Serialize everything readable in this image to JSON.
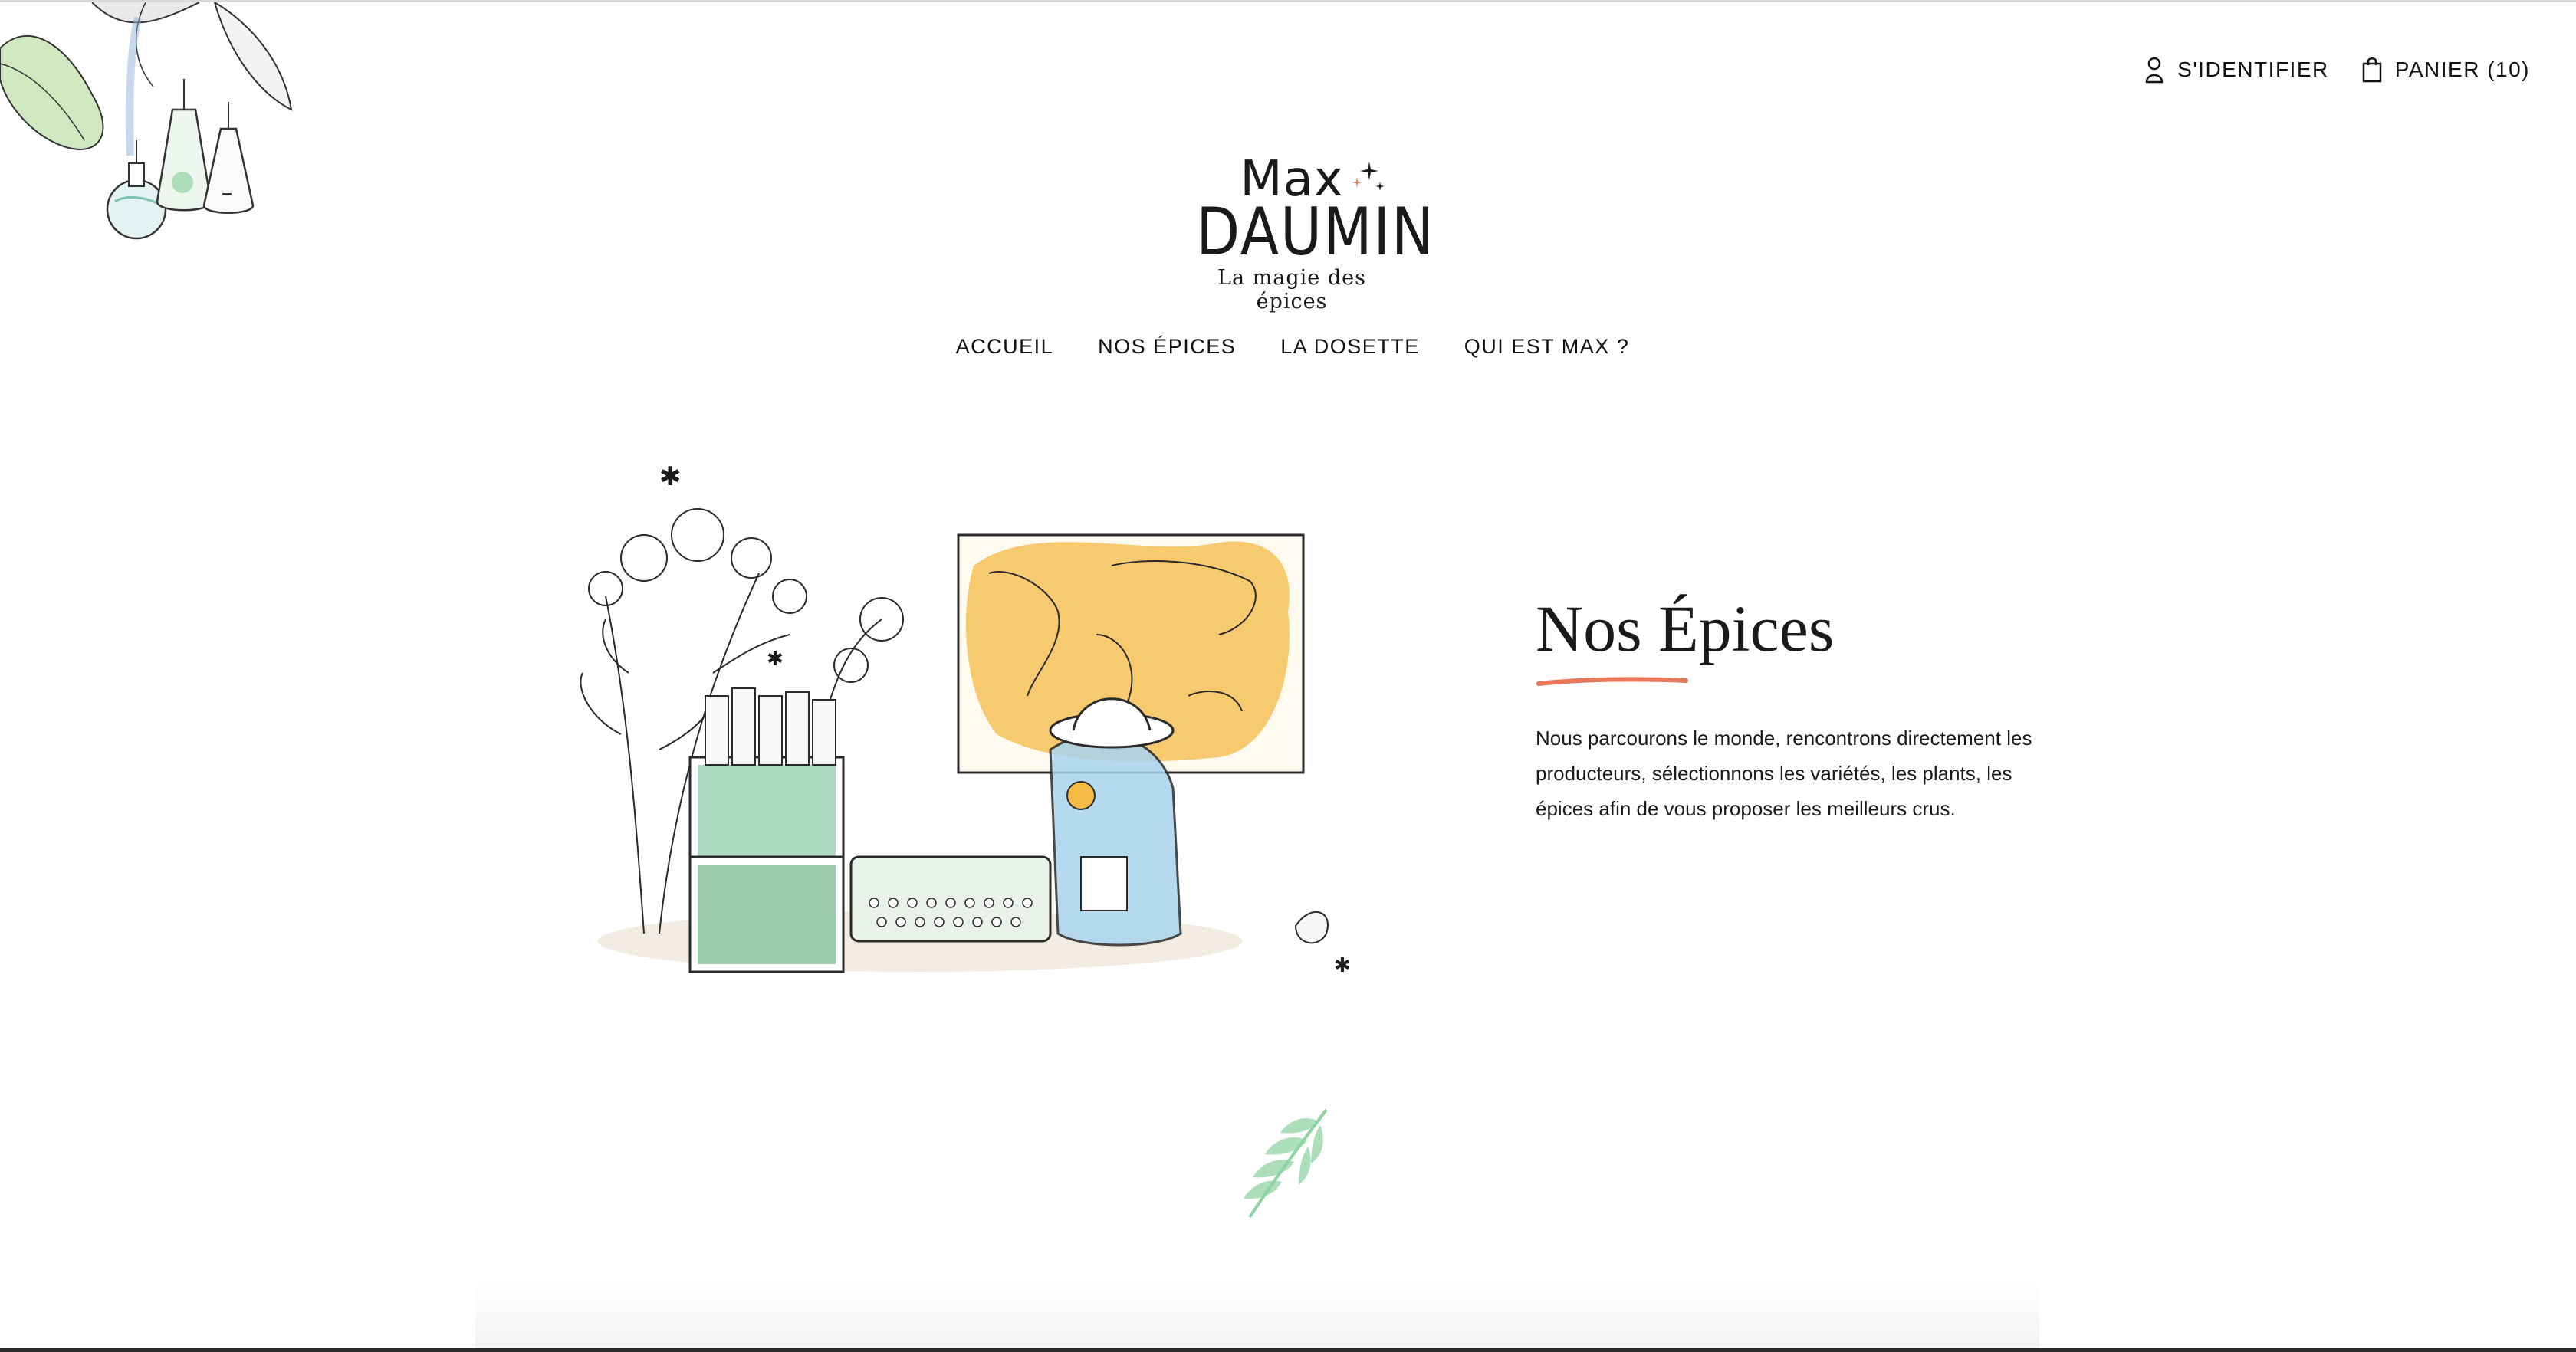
{
  "header": {
    "login_label": "S'IDENTIFIER",
    "cart_label": "PANIER (10)"
  },
  "logo": {
    "line1": "Max",
    "line2": "DAUMIN",
    "tagline": "La magie des épices"
  },
  "nav": {
    "items": [
      {
        "label": "ACCUEIL"
      },
      {
        "label": "NOS ÉPICES"
      },
      {
        "label": "LA DOSETTE"
      },
      {
        "label": "QUI EST MAX ?"
      }
    ]
  },
  "hero": {
    "title": "Nos Épices",
    "description": "Nous parcourons le monde, rencontrons directement les producteurs, sélectionnons les variétés, les plants, les épices afin de vous proposer les meilleurs crus."
  },
  "colors": {
    "accent": "#e8785a",
    "text": "#1a1a1a",
    "map_yellow": "#f5b946",
    "box_green": "#7fc49c",
    "bag_blue": "#a9d4ee"
  }
}
